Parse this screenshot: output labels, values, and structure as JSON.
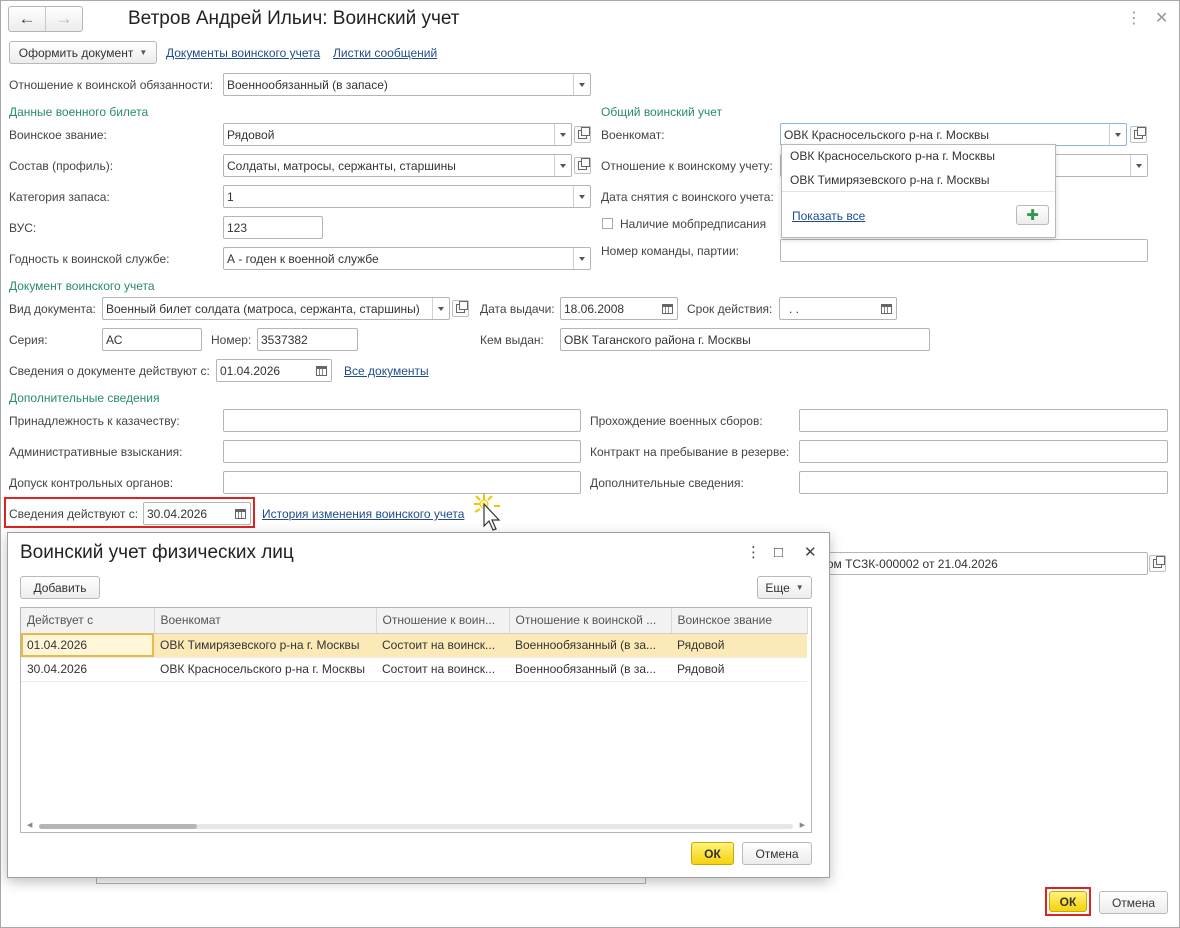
{
  "window": {
    "title": "Ветров Андрей Ильич: Воинский учет",
    "back_icon": "arrow-left-icon",
    "forward_icon": "arrow-right-icon",
    "more_icon": "more-vertical-icon",
    "close_icon": "close-icon"
  },
  "toolbar": {
    "create_doc_button": "Оформить документ",
    "link_docs": "Документы воинского учета",
    "link_messages": "Листки сообщений"
  },
  "attitude": {
    "label": "Отношение к воинской обязанности:",
    "value": "Военнообязанный (в запасе)"
  },
  "military_ticket": {
    "section": "Данные военного билета",
    "rank_label": "Воинское звание:",
    "rank": "Рядовой",
    "composition_label": "Состав (профиль):",
    "composition": "Солдаты, матросы, сержанты, старшины",
    "category_label": "Категория запаса:",
    "category": "1",
    "vus_label": "ВУС:",
    "vus": "123",
    "fitness_label": "Годность к воинской службе:",
    "fitness": "А - годен к военной службе"
  },
  "general_account": {
    "section": "Общий воинский учет",
    "commissariat_label": "Военкомат:",
    "commissariat": "ОВК Красносельского р-на г. Москвы",
    "relation_label": "Отношение к воинскому учету:",
    "removal_label": "Дата снятия с воинского учета:",
    "mob_label": "Наличие мобпредписания",
    "team_label": "Номер команды, партии:"
  },
  "commissariat_popup": {
    "items": [
      "ОВК Красносельского р-на г. Москвы",
      "ОВК Тимирязевского р-на г. Москвы"
    ],
    "show_all": "Показать все"
  },
  "document": {
    "section": "Документ воинского учета",
    "type_label": "Вид документа:",
    "type": "Военный билет солдата (матроса, сержанта, старшины)",
    "issue_label": "Дата выдачи:",
    "issue_date": "18.06.2008",
    "validity_label": "Срок действия:",
    "validity": ". .",
    "series_label": "Серия:",
    "series": "АС",
    "number_label": "Номер:",
    "number": "3537382",
    "issued_by_label": "Кем выдан:",
    "issued_by": "ОВК Таганского района г. Москвы",
    "valid_from_label": "Сведения о документе действуют с:",
    "valid_from": "01.04.2026",
    "all_docs_link": "Все документы"
  },
  "additional": {
    "section": "Дополнительные сведения",
    "cossack_label": "Принадлежность к казачеству:",
    "penalties_label": "Административные взыскания:",
    "access_label": "Допуск контрольных органов:",
    "trainings_label": "Прохождение военных сборов:",
    "contract_label": "Контракт на пребывание в резерве:",
    "extra_label": "Дополнительные сведения:"
  },
  "effective": {
    "label": "Сведения действуют с:",
    "date": "30.04.2026",
    "history_link": "История изменения воинского учета"
  },
  "background_text": "ссариатом ТСЗК-000002 от 21.04.2026",
  "dialog": {
    "title": "Воинский учет физических лиц",
    "add_button": "Добавить",
    "more_button": "Еще",
    "columns": [
      "Действует с",
      "Военкомат",
      "Отношение к воин...",
      "Отношение к воинской ...",
      "Воинское звание"
    ],
    "rows": [
      [
        "01.04.2026",
        "ОВК Тимирязевского р-на г. Москвы",
        "Состоит на воинск...",
        "Военнообязанный (в за...",
        "Рядовой"
      ],
      [
        "30.04.2026",
        "ОВК Красносельского р-на г. Москвы",
        "Состоит на воинск...",
        "Военнообязанный (в за...",
        "Рядовой"
      ]
    ],
    "ok": "ОК",
    "cancel": "Отмена"
  },
  "footer": {
    "ok": "ОК",
    "cancel": "Отмена"
  }
}
